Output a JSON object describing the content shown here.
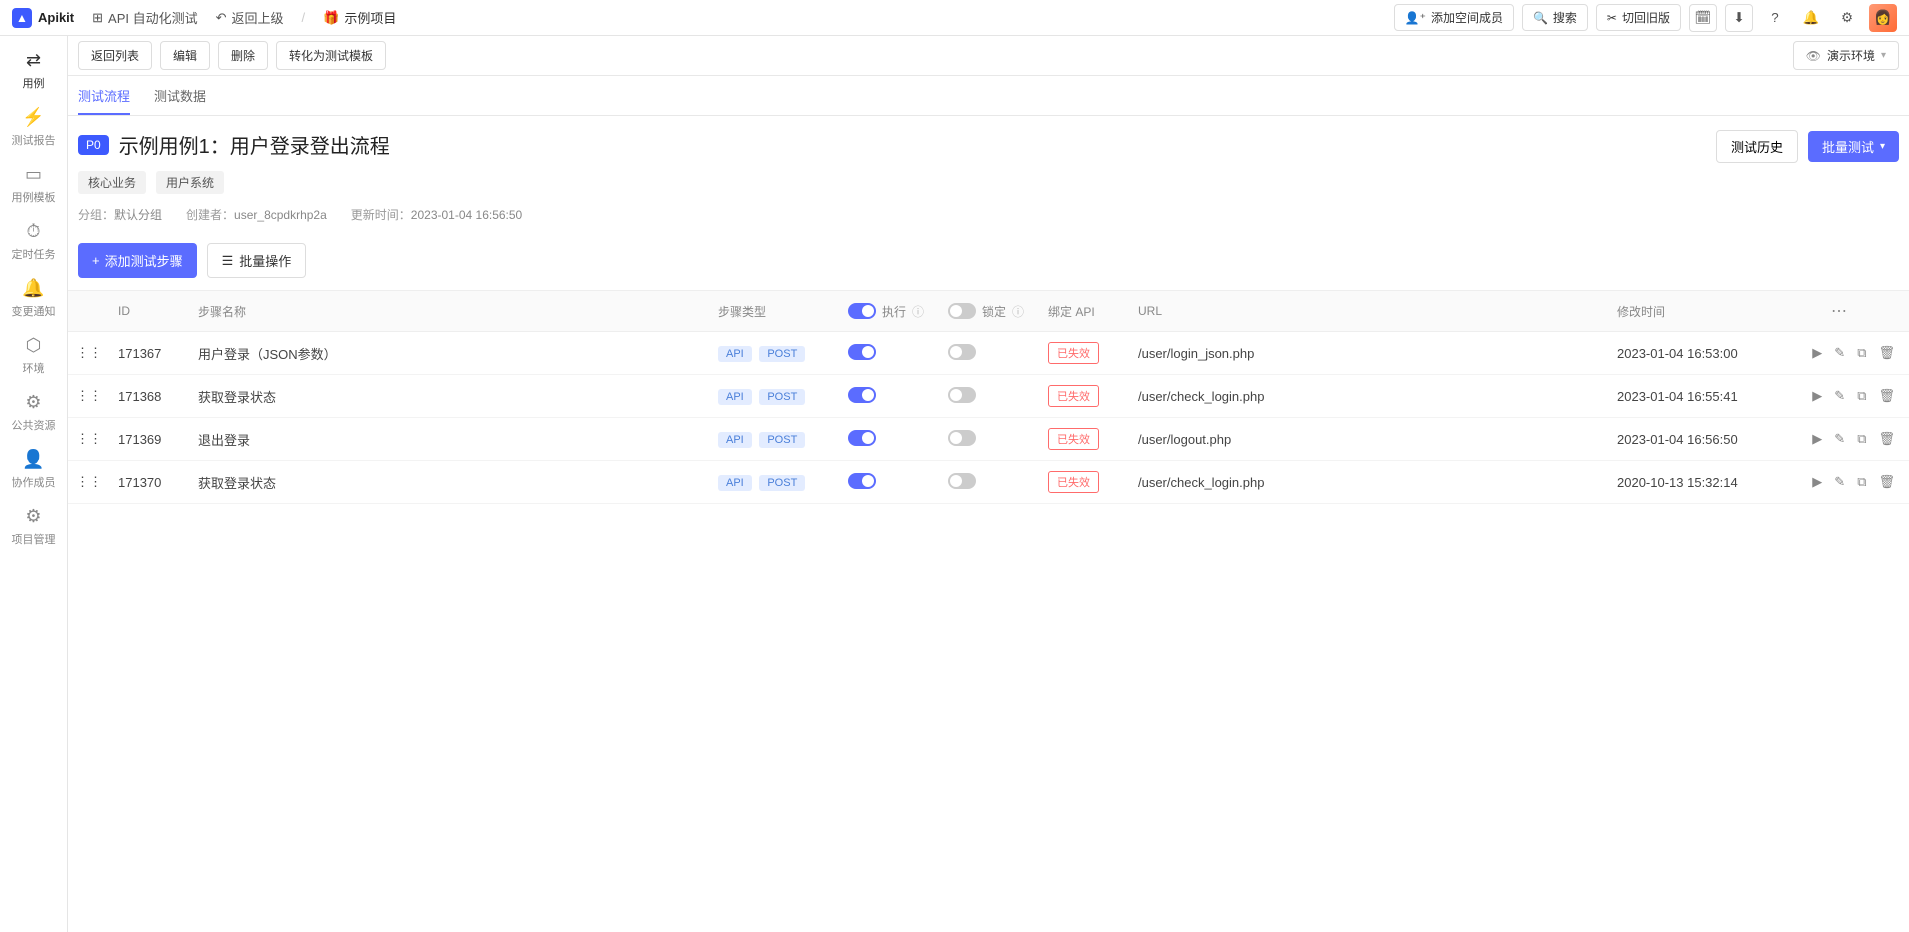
{
  "header": {
    "brand": "Apikit",
    "nav_auto_test": "API 自动化测试",
    "back_up": "返回上级",
    "project": "示例项目",
    "add_member": "添加空间成员",
    "search": "搜索",
    "switch_old": "切回旧版"
  },
  "sidebar": {
    "items": [
      {
        "label": "用例",
        "icon": "⇄"
      },
      {
        "label": "测试报告",
        "icon": "⚡"
      },
      {
        "label": "用例模板",
        "icon": "▭"
      },
      {
        "label": "定时任务",
        "icon": "⏱"
      },
      {
        "label": "变更通知",
        "icon": "🔔"
      },
      {
        "label": "环境",
        "icon": "⬡"
      },
      {
        "label": "公共资源",
        "icon": "⚙"
      },
      {
        "label": "协作成员",
        "icon": "👤"
      },
      {
        "label": "项目管理",
        "icon": "⚙"
      }
    ]
  },
  "toolbar": {
    "back_list": "返回列表",
    "edit": "编辑",
    "delete": "删除",
    "to_template": "转化为测试模板",
    "env_label": "演示环境"
  },
  "tabs": {
    "flow": "测试流程",
    "data": "测试数据"
  },
  "title": {
    "priority": "P0",
    "text": "示例用例1：用户登录登出流程",
    "history_btn": "测试历史",
    "batch_btn": "批量测试"
  },
  "tags": [
    "核心业务",
    "用户系统"
  ],
  "meta": {
    "group_label": "分组：",
    "group_val": "默认分组",
    "creator_label": "创建者：",
    "creator_val": "user_8cpdkrhp2a",
    "updated_label": "更新时间：",
    "updated_val": "2023-01-04 16:56:50"
  },
  "actions": {
    "add_step": "添加测试步骤",
    "bulk": "批量操作"
  },
  "table": {
    "headers": {
      "id": "ID",
      "step_name": "步骤名称",
      "step_type": "步骤类型",
      "execute": "执行",
      "lock": "锁定",
      "bind_api": "绑定 API",
      "url": "URL",
      "modified": "修改时间"
    },
    "api_pill": "API",
    "post_pill": "POST",
    "invalid_status": "已失效",
    "rows": [
      {
        "id": "171367",
        "name": "用户登录（JSON参数）",
        "exec": true,
        "lock": false,
        "url": "/user/login_json.php",
        "modified": "2023-01-04 16:53:00"
      },
      {
        "id": "171368",
        "name": "获取登录状态",
        "exec": true,
        "lock": false,
        "url": "/user/check_login.php",
        "modified": "2023-01-04 16:55:41"
      },
      {
        "id": "171369",
        "name": "退出登录",
        "exec": true,
        "lock": false,
        "url": "/user/logout.php",
        "modified": "2023-01-04 16:56:50"
      },
      {
        "id": "171370",
        "name": "获取登录状态",
        "exec": true,
        "lock": false,
        "url": "/user/check_login.php",
        "modified": "2020-10-13 15:32:14"
      }
    ]
  }
}
